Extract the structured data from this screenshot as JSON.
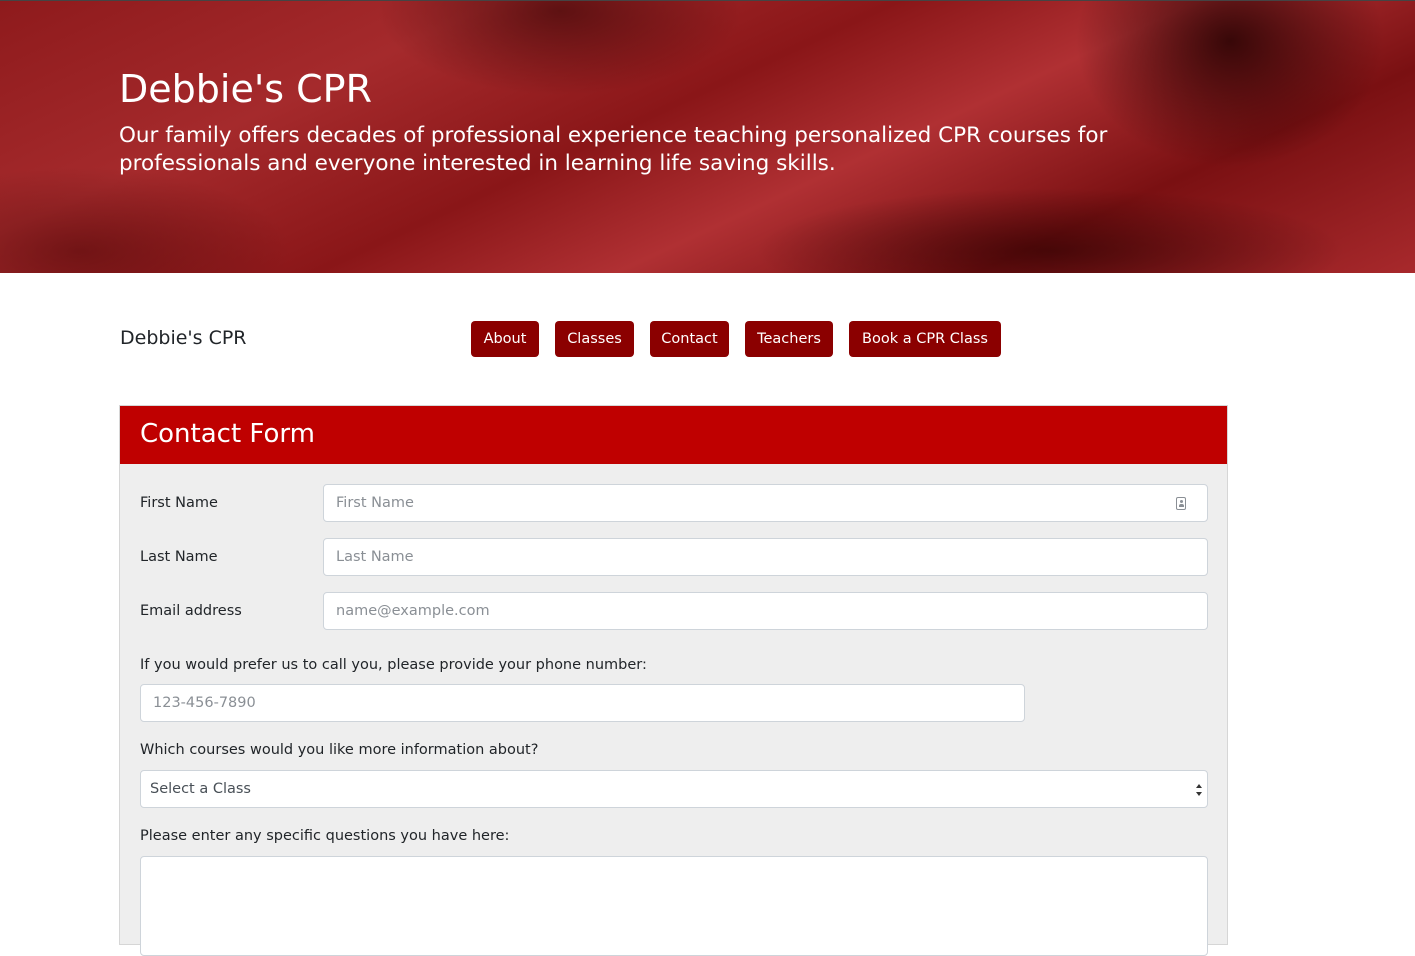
{
  "hero": {
    "title": "Debbie's CPR",
    "lead": "Our family offers decades of professional experience teaching personalized CPR courses for professionals and everyone interested in learning life saving skills."
  },
  "navbar": {
    "brand": "Debbie's CPR",
    "items": [
      {
        "label": "About"
      },
      {
        "label": "Classes"
      },
      {
        "label": "Contact"
      },
      {
        "label": "Teachers"
      },
      {
        "label": "Book a CPR Class"
      }
    ]
  },
  "form": {
    "title": "Contact Form",
    "first_name": {
      "label": "First Name",
      "placeholder": "First Name",
      "value": ""
    },
    "last_name": {
      "label": "Last Name",
      "placeholder": "Last Name",
      "value": ""
    },
    "email": {
      "label": "Email address",
      "placeholder": "name@example.com",
      "value": ""
    },
    "phone": {
      "label": "If you would prefer us to call you, please provide your phone number:",
      "placeholder": "123-456-7890",
      "value": ""
    },
    "course": {
      "label": "Which courses would you like more information about?",
      "selected": "Select a Class"
    },
    "questions": {
      "label": "Please enter any specific questions you have here:",
      "value": ""
    },
    "autofill_icon": "contact-card-icon"
  },
  "colors": {
    "hero_red": "#a52a2c",
    "nav_button": "#8b0000",
    "card_header": "#bf0000",
    "card_body": "#eeeeee"
  }
}
